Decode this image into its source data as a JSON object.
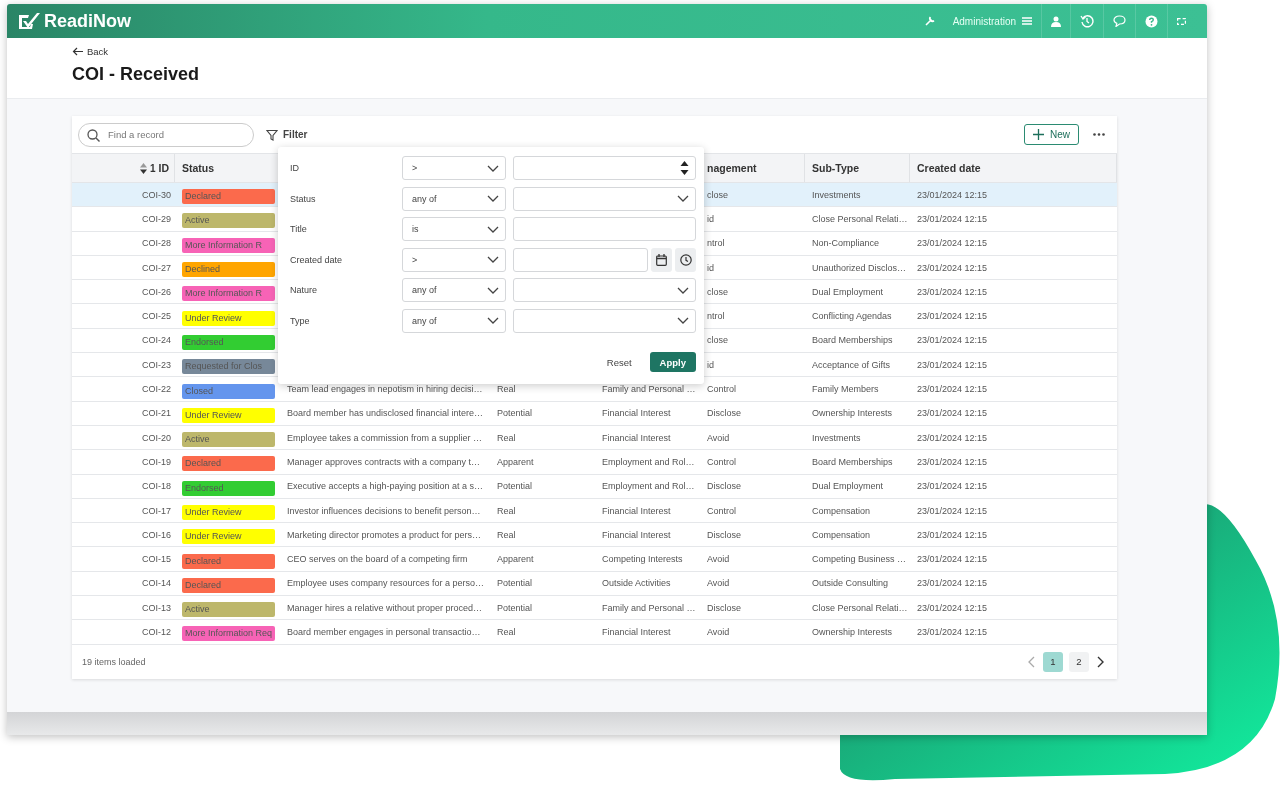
{
  "app": {
    "logo": "ReadiNow",
    "admin_label": "Administration"
  },
  "page": {
    "back": "Back",
    "title": "COI - Received"
  },
  "toolbar": {
    "search_placeholder": "Find a record",
    "filter": "Filter",
    "new": "New"
  },
  "table": {
    "columns": [
      {
        "kind": "id",
        "label": "ID",
        "sort": "1"
      },
      {
        "kind": "status",
        "label": "Status"
      },
      {
        "kind": "management",
        "label": "nagement"
      },
      {
        "kind": "sub_type",
        "label": "Sub-Type"
      },
      {
        "kind": "created",
        "label": "Created date"
      }
    ],
    "rows": [
      {
        "id": "COI-30",
        "status": "Declared",
        "color": "#fb6a4c",
        "management": "close",
        "sub_type": "Investments",
        "created": "23/01/2024 12:15",
        "selected": true
      },
      {
        "id": "COI-29",
        "status": "Active",
        "color": "#bdb76b",
        "management": "id",
        "sub_type": "Close Personal Relati…",
        "created": "23/01/2024 12:15",
        "selected": false
      },
      {
        "id": "COI-28",
        "status": "More Information R",
        "color": "#f763b6",
        "management": "ntrol",
        "sub_type": "Non-Compliance",
        "created": "23/01/2024 12:15",
        "selected": false
      },
      {
        "id": "COI-27",
        "status": "Declined",
        "color": "#ffa500",
        "management": "id",
        "sub_type": "Unauthorized Disclos…",
        "created": "23/01/2024 12:15",
        "selected": false
      },
      {
        "id": "COI-26",
        "status": "More Information R",
        "color": "#f763b6",
        "management": "close",
        "sub_type": "Dual Employment",
        "created": "23/01/2024 12:15",
        "selected": false
      },
      {
        "id": "COI-25",
        "status": "Under Review",
        "color": "#ffff00",
        "management": "ntrol",
        "sub_type": "Conflicting Agendas",
        "created": "23/01/2024 12:15",
        "selected": false
      },
      {
        "id": "COI-24",
        "status": "Endorsed",
        "color": "#32cd32",
        "management": "close",
        "sub_type": "Board Memberships",
        "created": "23/01/2024 12:15",
        "selected": false
      },
      {
        "id": "COI-23",
        "status": "Requested for Clos",
        "color": "#778899",
        "management": "id",
        "sub_type": "Acceptance of Gifts",
        "created": "23/01/2024 12:15",
        "selected": false
      },
      {
        "id": "COI-22",
        "status": "Closed",
        "color": "#6495ed",
        "title": "Team lead engages in nepotism in hiring decisi…",
        "nature": "Real",
        "type": "Family and Personal …",
        "management": "Control",
        "sub_type": "Family Members",
        "created": "23/01/2024 12:15",
        "selected": false
      },
      {
        "id": "COI-21",
        "status": "Under Review",
        "color": "#ffff00",
        "title": "Board member has undisclosed financial intere…",
        "nature": "Potential",
        "type": "Financial Interest",
        "management": "Disclose",
        "sub_type": "Ownership Interests",
        "created": "23/01/2024 12:15",
        "selected": false
      },
      {
        "id": "COI-20",
        "status": "Active",
        "color": "#bdb76b",
        "title": "Employee takes a commission from a supplier …",
        "nature": "Real",
        "type": "Financial Interest",
        "management": "Avoid",
        "sub_type": "Investments",
        "created": "23/01/2024 12:15",
        "selected": false
      },
      {
        "id": "COI-19",
        "status": "Declared",
        "color": "#fb6a4c",
        "title": "Manager approves contracts with a company t…",
        "nature": "Apparent",
        "type": "Employment and Rol…",
        "management": "Control",
        "sub_type": "Board Memberships",
        "created": "23/01/2024 12:15",
        "selected": false
      },
      {
        "id": "COI-18",
        "status": "Endorsed",
        "color": "#32cd32",
        "title": "Executive accepts a high-paying position at a s…",
        "nature": "Potential",
        "type": "Employment and Rol…",
        "management": "Disclose",
        "sub_type": "Dual Employment",
        "created": "23/01/2024 12:15",
        "selected": false
      },
      {
        "id": "COI-17",
        "status": "Under Review",
        "color": "#ffff00",
        "title": "Investor influences decisions to benefit person…",
        "nature": "Real",
        "type": "Financial Interest",
        "management": "Control",
        "sub_type": "Compensation",
        "created": "23/01/2024 12:15",
        "selected": false
      },
      {
        "id": "COI-16",
        "status": "Under Review",
        "color": "#ffff00",
        "title": "Marketing director promotes a product for pers…",
        "nature": "Real",
        "type": "Financial Interest",
        "management": "Disclose",
        "sub_type": "Compensation",
        "created": "23/01/2024 12:15",
        "selected": false
      },
      {
        "id": "COI-15",
        "status": "Declared",
        "color": "#fb6a4c",
        "title": "CEO serves on the board of a competing firm",
        "nature": "Apparent",
        "type": "Competing Interests",
        "management": "Avoid",
        "sub_type": "Competing Business …",
        "created": "23/01/2024 12:15",
        "selected": false
      },
      {
        "id": "COI-14",
        "status": "Declared",
        "color": "#fb6a4c",
        "title": "Employee uses company resources for a perso…",
        "nature": "Potential",
        "type": "Outside Activities",
        "management": "Avoid",
        "sub_type": "Outside Consulting",
        "created": "23/01/2024 12:15",
        "selected": false
      },
      {
        "id": "COI-13",
        "status": "Active",
        "color": "#bdb76b",
        "title": "Manager hires a relative without proper proced…",
        "nature": "Potential",
        "type": "Family and Personal …",
        "management": "Disclose",
        "sub_type": "Close Personal Relati…",
        "created": "23/01/2024 12:15",
        "selected": false
      },
      {
        "id": "COI-12",
        "status": "More Information Req",
        "color": "#f763b6",
        "title": "Board member engages in personal transactio…",
        "nature": "Real",
        "type": "Financial Interest",
        "management": "Avoid",
        "sub_type": "Ownership Interests",
        "created": "23/01/2024 12:15",
        "selected": false
      }
    ]
  },
  "filter": {
    "fields": [
      {
        "label": "ID",
        "operator": ">",
        "kind": "number"
      },
      {
        "label": "Status",
        "operator": "any of",
        "kind": "select"
      },
      {
        "label": "Title",
        "operator": "is",
        "kind": "text"
      },
      {
        "label": "Created date",
        "operator": ">",
        "kind": "datetime"
      },
      {
        "label": "Nature",
        "operator": "any of",
        "kind": "select"
      },
      {
        "label": "Type",
        "operator": "any of",
        "kind": "select"
      }
    ],
    "reset": "Reset",
    "apply": "Apply"
  },
  "footer": {
    "count": "19 items loaded",
    "pages": [
      {
        "label": "1",
        "selected": true
      },
      {
        "label": "2",
        "selected": false
      }
    ]
  }
}
